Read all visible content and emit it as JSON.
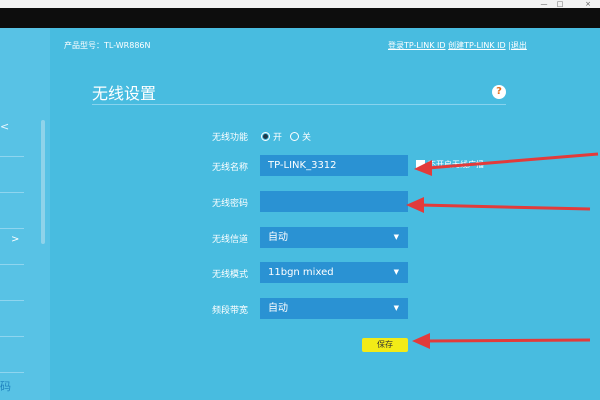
{
  "header": {
    "model_label": "产品型号：TL-WR886N",
    "login_link": "登录TP-LINK ID",
    "create_link": "创建TP-LINK ID",
    "separator": "|",
    "logout": "退出"
  },
  "page": {
    "title": "无线设置",
    "help_icon_text": "?"
  },
  "sidebar": {
    "top_partial": "<",
    "chevron": ">",
    "bottom_partial": "码"
  },
  "form": {
    "wireless_function": {
      "label": "无线功能",
      "on": "开",
      "off": "关",
      "selected": "开"
    },
    "ssid": {
      "label": "无线名称",
      "value": "TP-LINK_3312",
      "hide_label": "不开启无线广播"
    },
    "password": {
      "label": "无线密码",
      "value": ""
    },
    "channel": {
      "label": "无线信道",
      "value": "自动"
    },
    "mode": {
      "label": "无线模式",
      "value": "11bgn mixed"
    },
    "bandwidth": {
      "label": "频段带宽",
      "value": "自动"
    },
    "save_label": "保存"
  },
  "colors": {
    "background": "#48bce0",
    "field": "#2a92d3",
    "save_button": "#f2eb17",
    "arrow": "#e23b3b"
  }
}
